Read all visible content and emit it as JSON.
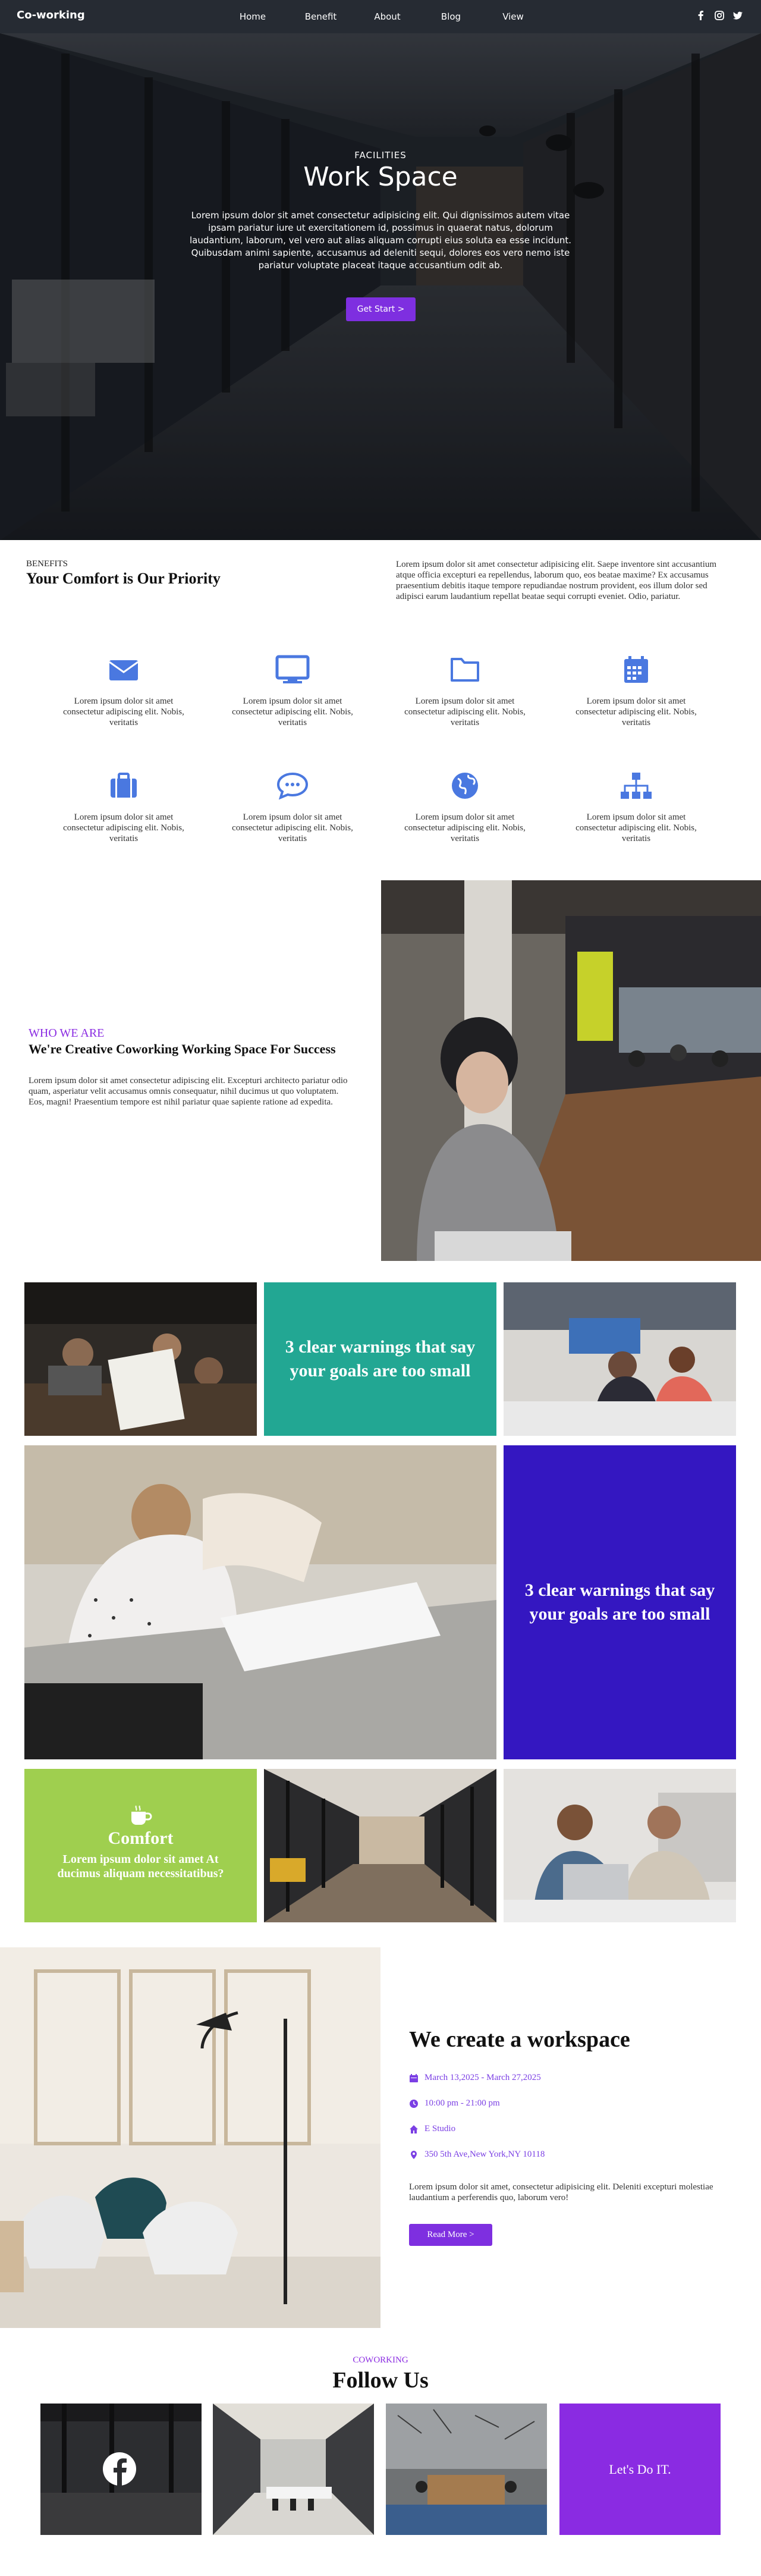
{
  "nav": {
    "brand": "Co-working",
    "items": [
      "Home",
      "Benefit",
      "About",
      "Blog",
      "View"
    ],
    "social_icons": [
      "facebook-icon",
      "instagram-icon",
      "twitter-icon"
    ]
  },
  "hero": {
    "kicker": "FACILITIES",
    "title": "Work Space",
    "text": "Lorem ipsum dolor sit amet consectetur adipisicing elit. Qui dignissimos autem vitae ipsam pariatur iure ut exercitationem id, possimus in quaerat natus, dolorum laudantium, laborum, vel vero aut alias aliquam corrupti eius soluta ea esse incidunt. Quibusdam animi sapiente, accusamus ad deleniti sequi, dolores eos vero nemo iste pariatur voluptate placeat itaque accusantium odit ab.",
    "button": "Get Start >"
  },
  "benefits": {
    "kicker": "BENEFITS",
    "title": "Your Comfort is Our Priority",
    "text": "Lorem ipsum dolor sit amet consectetur adipisicing elit. Saepe inventore sint accusantium atque officia excepturi ea repellendus, laborum quo, eos beatae maxime? Ex accusamus praesentium debitis itaque tempore repudiandae nostrum provident, eos illum dolor sed adipisci earum laudantium repellat beatae sequi corrupti eveniet. Odio, pariatur.",
    "features": [
      {
        "icon": "envelope-icon",
        "text": "Lorem ipsum dolor sit amet consectetur adipiscing elit. Nobis, veritatis"
      },
      {
        "icon": "monitor-icon",
        "text": "Lorem ipsum dolor sit amet consectetur adipiscing elit. Nobis, veritatis"
      },
      {
        "icon": "folder-icon",
        "text": "Lorem ipsum dolor sit amet consectetur adipiscing elit. Nobis, veritatis"
      },
      {
        "icon": "calendar-icon",
        "text": "Lorem ipsum dolor sit amet consectetur adipiscing elit. Nobis, veritatis"
      },
      {
        "icon": "suitcase-icon",
        "text": "Lorem ipsum dolor sit amet consectetur adipiscing elit. Nobis, veritatis"
      },
      {
        "icon": "chat-bubble-icon",
        "text": "Lorem ipsum dolor sit amet consectetur adipiscing elit. Nobis, veritatis"
      },
      {
        "icon": "globe-icon",
        "text": "Lorem ipsum dolor sit amet consectetur adipiscing elit. Nobis, veritatis"
      },
      {
        "icon": "sitemap-icon",
        "text": "Lorem ipsum dolor sit amet consectetur adipiscing elit. Nobis, veritatis"
      }
    ]
  },
  "who": {
    "kicker": "WHO WE ARE",
    "title": "We're Creative Coworking Working Space For Success",
    "text": "Lorem ipsum dolor sit amet consectetur adipiscing elit. Excepturi architecto pariatur odio quam, asperiatur velit accusamus omnis consequatur, nihil ducimus ut quo voluptatem. Eos, magni! Praesentium tempore est nihil pariatur quae sapiente ratione ad expedita."
  },
  "gallery": {
    "tile1_text": "3 clear warnings that say your goals are too small",
    "tile2_text": "3 clear warnings that say your goals are too small",
    "comfort_title": "Comfort",
    "comfort_text": "Lorem ipsum dolor sit amet At ducimus aliquam necessitatibus?",
    "colors": {
      "teal": "#22a793",
      "indigo": "#3417c1",
      "green": "#9fcf4f"
    }
  },
  "event": {
    "title": "We create a workspace",
    "date": "March 13,2025 - March 27,2025",
    "time": "10:00 pm - 21:00 pm",
    "place": "E Studio",
    "address": "350 5th Ave,New York,NY 10118",
    "text": "Lorem ipsum dolor sit amet, consectetur adipisicing elit. Deleniti excepturi molestiae laudantium a perferendis quo, laborum vero!",
    "button": "Read More >"
  },
  "follow": {
    "kicker": "COWORKING",
    "title": "Follow Us",
    "cta": "Let's Do IT."
  },
  "accent": "#7e2fe0"
}
